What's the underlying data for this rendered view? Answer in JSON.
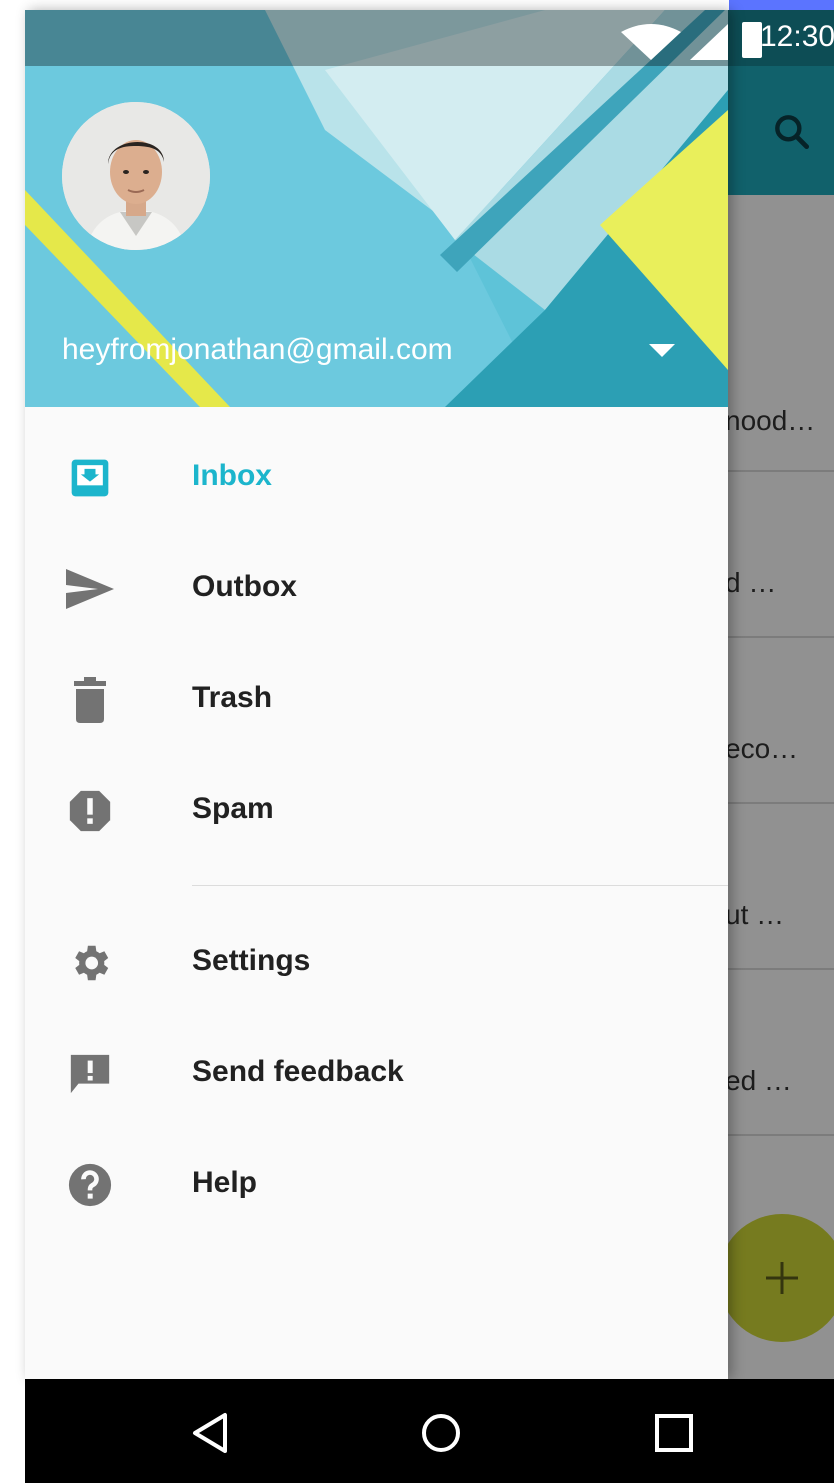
{
  "status_bar": {
    "time": "12:30"
  },
  "account": {
    "email": "heyfromjonathan@gmail.com"
  },
  "drawer": {
    "primary_items": [
      {
        "label": "Inbox",
        "icon": "inbox-icon",
        "active": true
      },
      {
        "label": "Outbox",
        "icon": "send-icon",
        "active": false
      },
      {
        "label": "Trash",
        "icon": "trash-icon",
        "active": false
      },
      {
        "label": "Spam",
        "icon": "spam-icon",
        "active": false
      }
    ],
    "secondary_items": [
      {
        "label": "Settings",
        "icon": "gear-icon"
      },
      {
        "label": "Send feedback",
        "icon": "feedback-icon"
      },
      {
        "label": "Help",
        "icon": "help-icon"
      }
    ]
  },
  "background_list": {
    "snippets": [
      "nood…",
      "d …",
      "eco…",
      "ut …",
      "ed …"
    ]
  },
  "colors": {
    "accent": "#1cb5cc",
    "toolbar": "#1ea7b8",
    "fab": "#ccd436",
    "header_bg": "#4db8cf"
  }
}
